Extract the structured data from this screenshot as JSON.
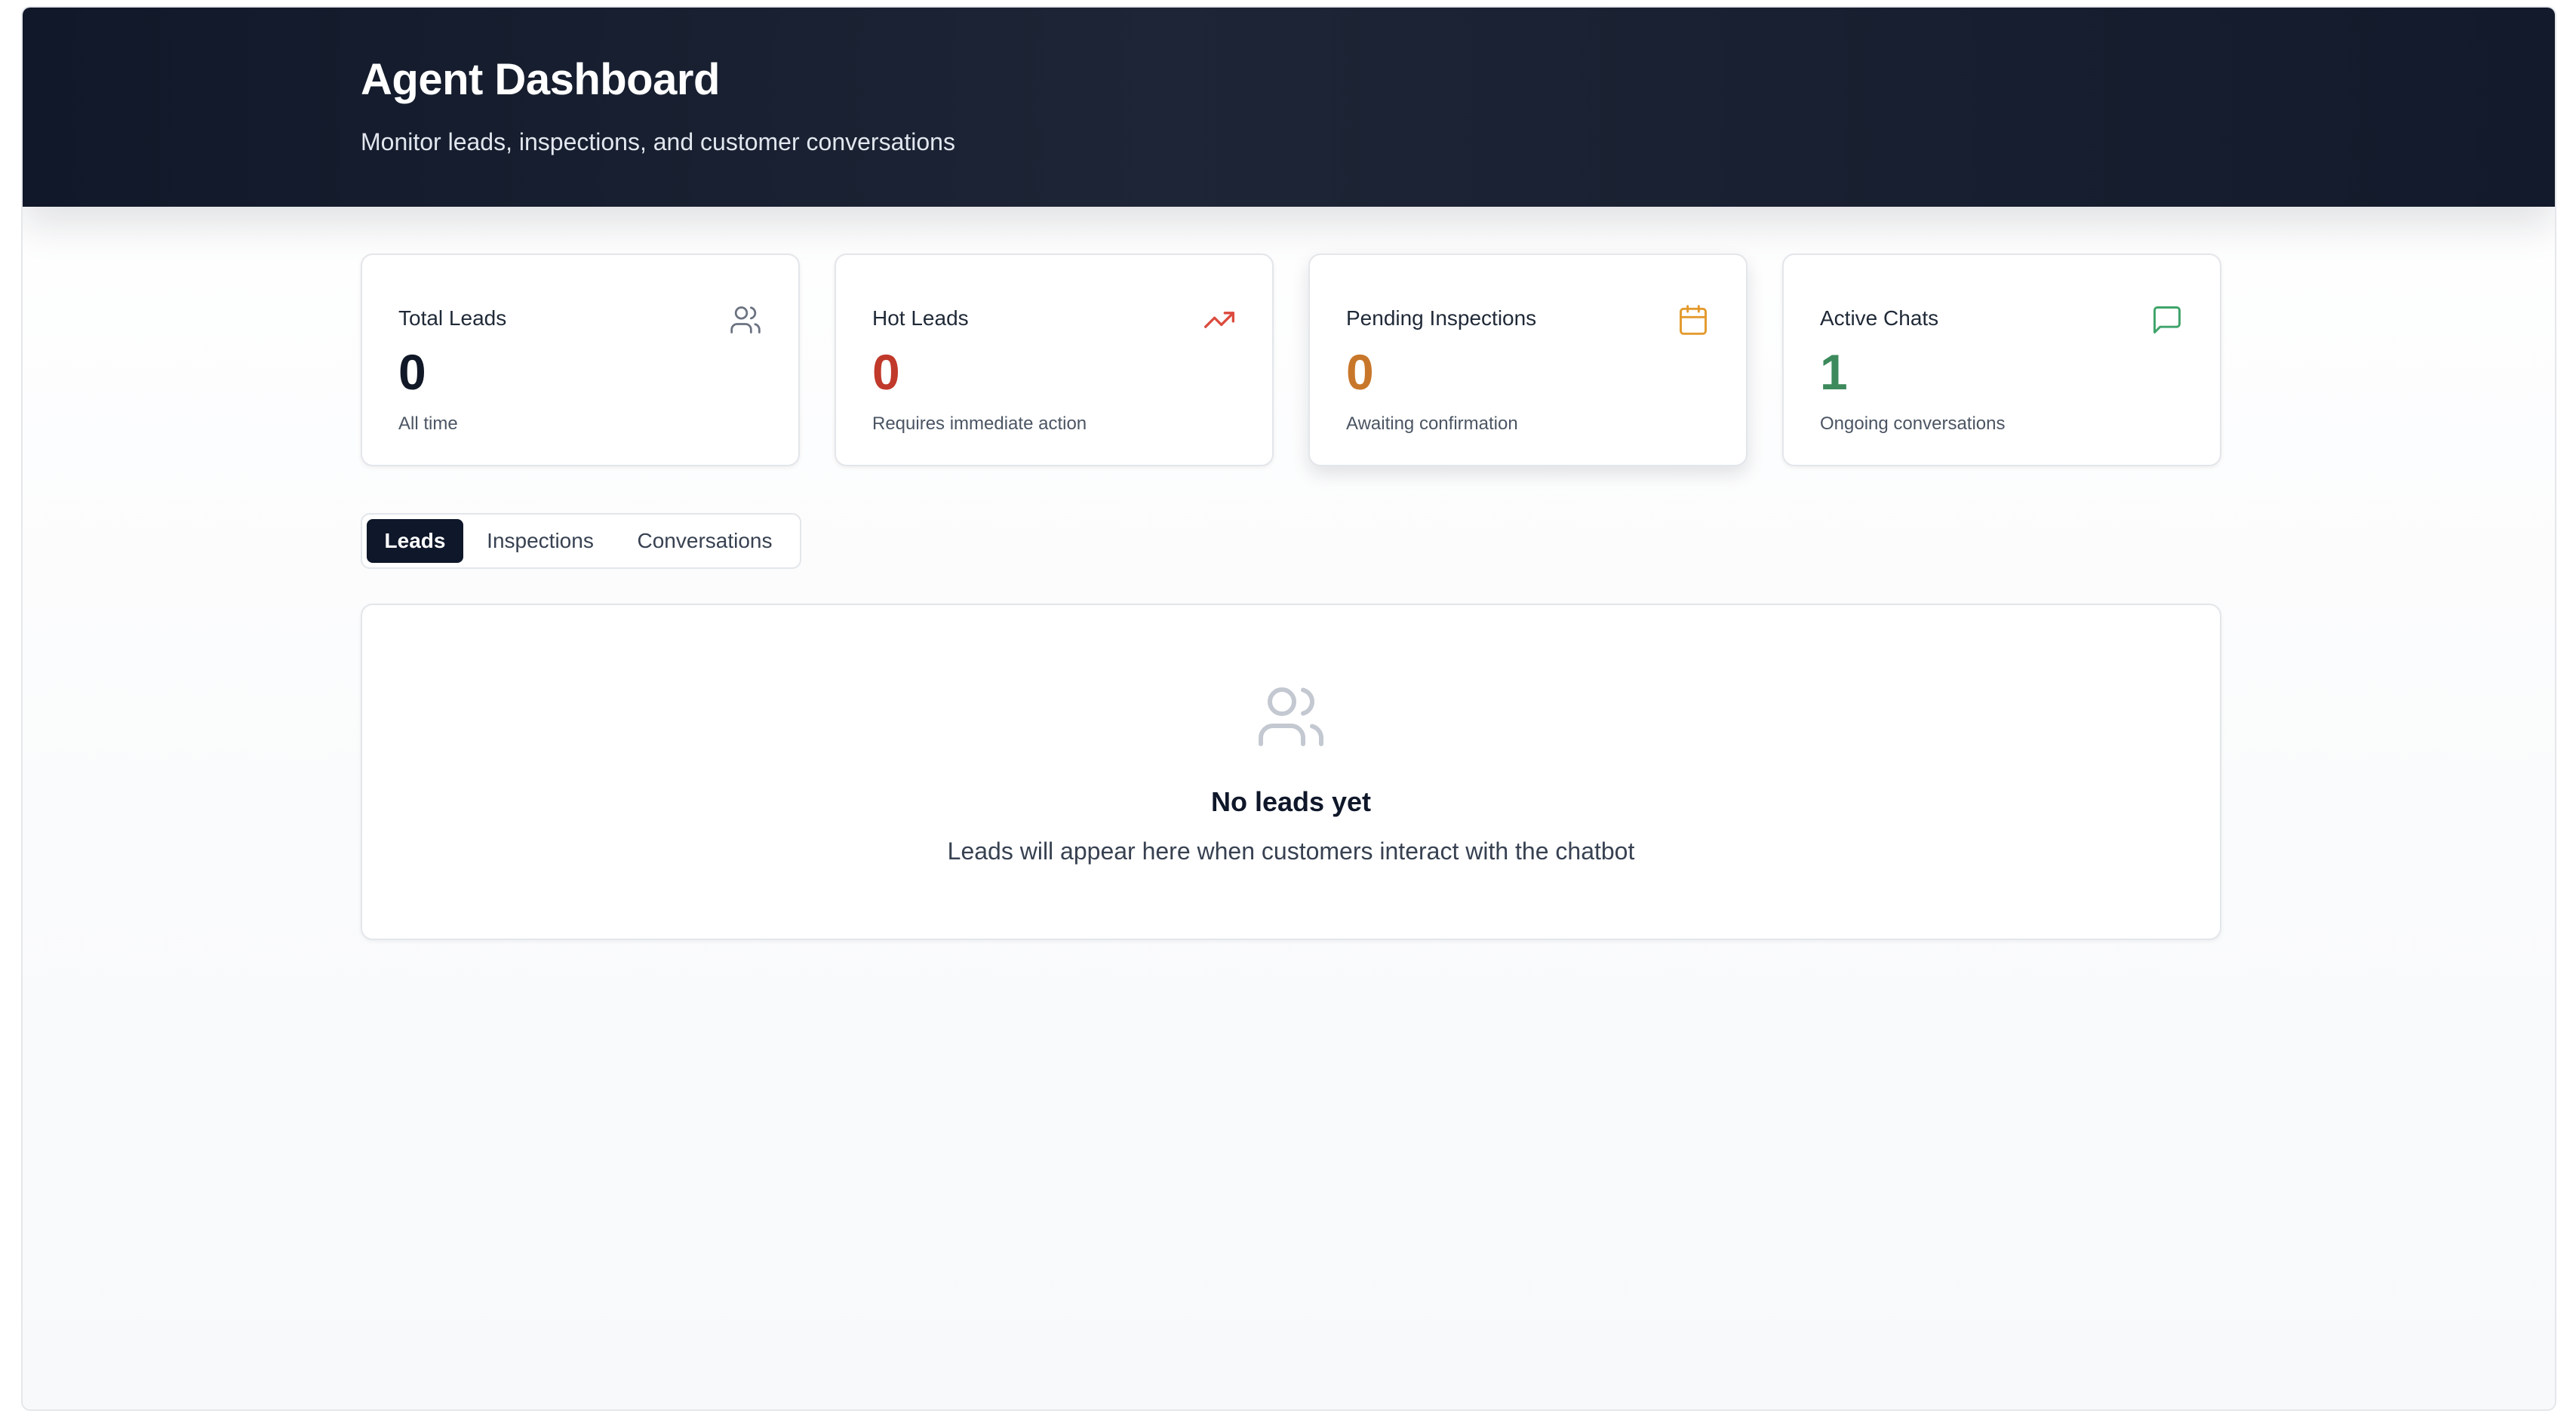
{
  "header": {
    "title": "Agent Dashboard",
    "subtitle": "Monitor leads, inspections, and customer conversations"
  },
  "stats": [
    {
      "label": "Total Leads",
      "value": "0",
      "note": "All time",
      "icon": "users-icon",
      "color": "#111827",
      "icon_color": "#6b7280"
    },
    {
      "label": "Hot Leads",
      "value": "0",
      "note": "Requires immediate action",
      "icon": "trending-up-icon",
      "color": "#c0392b",
      "icon_color": "#dc4a3d"
    },
    {
      "label": "Pending Inspections",
      "value": "0",
      "note": "Awaiting confirmation",
      "icon": "calendar-icon",
      "color": "#c8772a",
      "icon_color": "#e39a2d"
    },
    {
      "label": "Active Chats",
      "value": "1",
      "note": "Ongoing conversations",
      "icon": "message-square-icon",
      "color": "#3d8a5c",
      "icon_color": "#3fa46a"
    }
  ],
  "tabs": [
    {
      "label": "Leads",
      "active": true
    },
    {
      "label": "Inspections",
      "active": false
    },
    {
      "label": "Conversations",
      "active": false
    }
  ],
  "empty_state": {
    "icon": "users-icon",
    "title": "No leads yet",
    "description": "Leads will appear here when customers interact with the chatbot"
  }
}
